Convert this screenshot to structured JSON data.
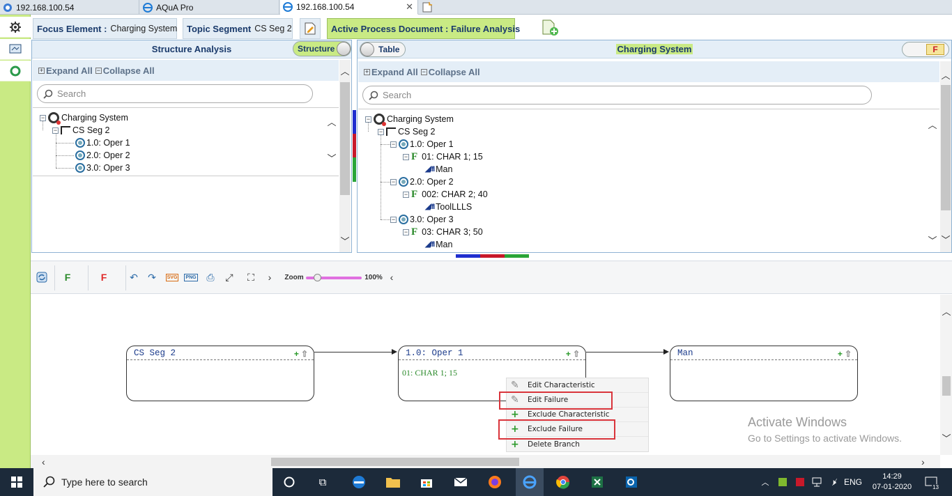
{
  "browser_tabs": [
    {
      "label": "192.168.100.54",
      "active": false
    },
    {
      "label": "AQuA Pro",
      "active": false
    },
    {
      "label": "192.168.100.54",
      "active": true
    }
  ],
  "header": {
    "focus_label": "Focus Element :",
    "focus_value": "Charging System",
    "topic_label": "Topic Segment",
    "topic_value": "CS Seg 2",
    "active_doc": "Active Process Document : Failure Analysis"
  },
  "left_panel": {
    "title": "Structure Analysis",
    "toggle_label": "Structure",
    "expand_all": "Expand All",
    "collapse_all": "Collapse All",
    "search_placeholder": "Search",
    "tree": {
      "root": "Charging System",
      "segment": "CS Seg 2",
      "ops": [
        "1.0: Oper 1",
        "2.0: Oper 2",
        "3.0: Oper 3"
      ]
    }
  },
  "right_panel": {
    "title": "Charging System",
    "toggle_label": "Table",
    "badge": "F",
    "expand_all": "Expand All",
    "collapse_all": "Collapse All",
    "search_placeholder": "Search",
    "tree": {
      "root": "Charging System",
      "segment": "CS Seg 2",
      "ops": [
        {
          "label": "1.0: Oper 1",
          "char": "01: CHAR 1; 15",
          "leaf": "Man"
        },
        {
          "label": "2.0: Oper 2",
          "char": "002: CHAR 2; 40",
          "leaf": "ToolLLLS"
        },
        {
          "label": "3.0: Oper 3",
          "char": "03: CHAR 3; 50",
          "leaf": "Man"
        }
      ]
    }
  },
  "toolbar": {
    "f_green": "F",
    "f_red": "F",
    "svg": "SVG",
    "png": "PNG",
    "zoom_label": "Zoom",
    "zoom_value": "100%",
    "zoom_fraction": 0.2
  },
  "diagram": {
    "nodes": [
      {
        "title": "CS Seg 2",
        "body": ""
      },
      {
        "title": "1.0: Oper 1",
        "body": "01: CHAR 1; 15"
      },
      {
        "title": "Man",
        "body": ""
      }
    ]
  },
  "context_menu": [
    "Edit Characteristic",
    "Edit Failure",
    "Exclude Characteristic",
    "Exclude Failure",
    "Delete Branch"
  ],
  "watermark": {
    "line1": "Activate Windows",
    "line2": "Go to Settings to activate Windows."
  },
  "taskbar": {
    "search_placeholder": "Type here to search",
    "lang": "ENG",
    "time": "14:29",
    "date": "07-01-2020",
    "notif_count": "13"
  },
  "colors": {
    "accent_green": "#c9ea84",
    "header_blue": "#1a3a6b",
    "highlight_red": "#d9343b"
  }
}
